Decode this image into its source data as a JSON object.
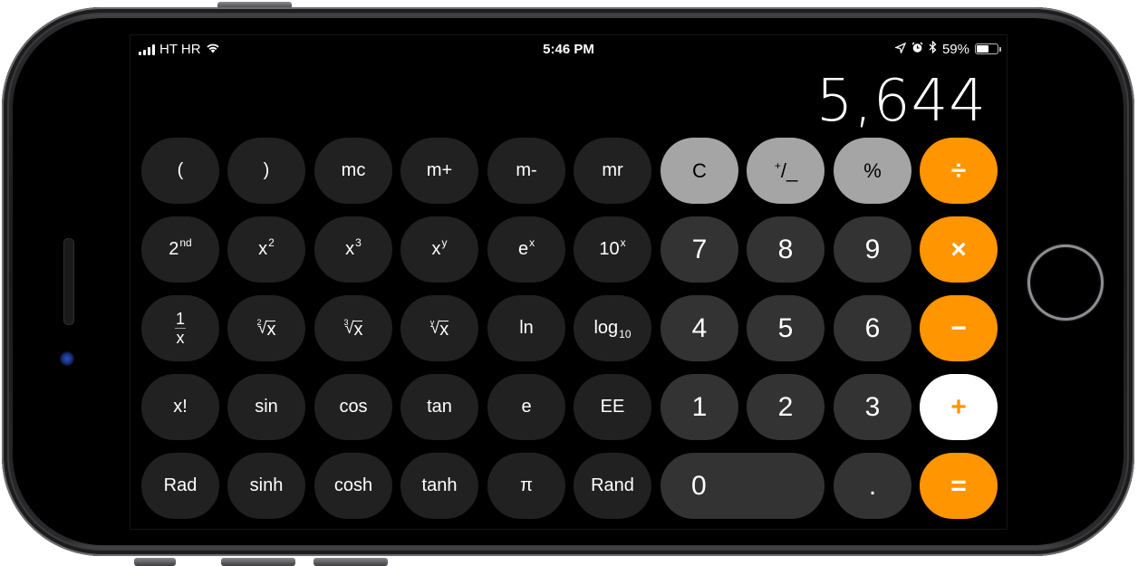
{
  "status_bar": {
    "carrier": "HT HR",
    "time": "5:46 PM",
    "battery_percent": "59%",
    "battery_level": 0.59,
    "icons": [
      "signal-icon",
      "wifi-icon",
      "location-icon",
      "alarm-icon",
      "bluetooth-icon",
      "battery-icon"
    ]
  },
  "display": {
    "value": "5,644"
  },
  "colors": {
    "function_key": "#212121",
    "digit_key": "#333333",
    "light_key": "#a5a5a5",
    "operator_key": "#ff9500",
    "operator_active": "#ffffff"
  },
  "keys": {
    "open_paren": "(",
    "close_paren": ")",
    "mc": "mc",
    "m_plus": "m+",
    "m_minus": "m-",
    "mr": "mr",
    "clear": "C",
    "plus_minus": {
      "plus": "+",
      "rest": "/_"
    },
    "percent": "%",
    "divide": "÷",
    "second": {
      "base": "2",
      "sup": "nd"
    },
    "x_squared": {
      "base": "x",
      "sup": "2"
    },
    "x_cubed": {
      "base": "x",
      "sup": "3"
    },
    "x_pow_y": {
      "base": "x",
      "sup": "y"
    },
    "e_pow_x": {
      "base": "e",
      "sup": "x"
    },
    "ten_pow_x": {
      "base": "10",
      "sup": "x"
    },
    "seven": "7",
    "eight": "8",
    "nine": "9",
    "multiply": "×",
    "reciprocal": {
      "num": "1",
      "den": "x"
    },
    "sqrt": {
      "index": "2",
      "rad": "√",
      "arg": "x"
    },
    "cbrt": {
      "index": "3",
      "rad": "√",
      "arg": "x"
    },
    "yroot": {
      "index": "y",
      "rad": "√",
      "arg": "x"
    },
    "ln": "ln",
    "log10": {
      "base": "log",
      "sub": "10"
    },
    "four": "4",
    "five": "5",
    "six": "6",
    "minus": "−",
    "factorial": "x!",
    "sin": "sin",
    "cos": "cos",
    "tan": "tan",
    "e": "e",
    "ee": "EE",
    "one": "1",
    "two": "2",
    "three": "3",
    "plus": "+",
    "rad": "Rad",
    "sinh": "sinh",
    "cosh": "cosh",
    "tanh": "tanh",
    "pi": "π",
    "rand": "Rand",
    "zero": "0",
    "decimal": ".",
    "equals": "="
  }
}
